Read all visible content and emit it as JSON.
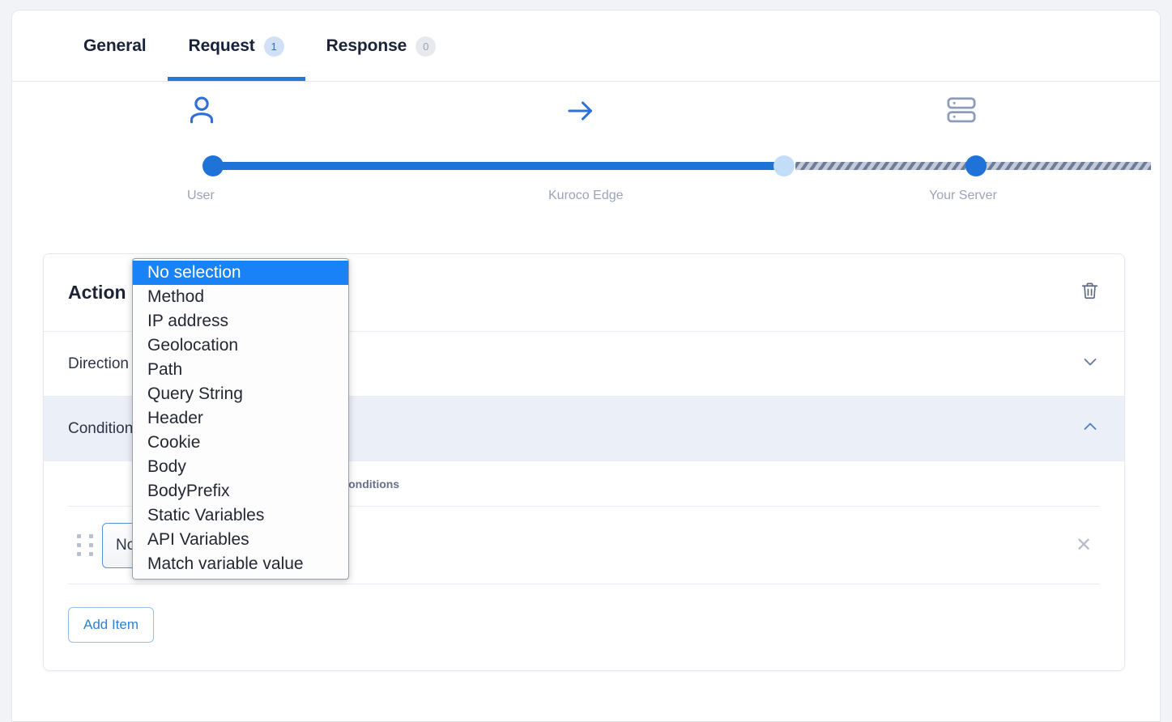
{
  "tabs": [
    {
      "label": "General",
      "badge": null,
      "active": false
    },
    {
      "label": "Request",
      "badge": "1",
      "active": true
    },
    {
      "label": "Response",
      "badge": "0",
      "active": false
    }
  ],
  "flow": {
    "icons": {
      "user": "user-icon",
      "arrow": "arrow-right-icon",
      "server": "server-icon"
    },
    "labels": {
      "start": "User",
      "middle": "Kuroco Edge",
      "end": "Your Server"
    }
  },
  "card": {
    "title": "Action",
    "delete_icon": "trash-icon",
    "rows": [
      {
        "label": "Direction",
        "state": "collapsed",
        "icon": "chevron-down-icon"
      },
      {
        "label": "Conditions",
        "state": "expanded",
        "icon": "chevron-up-icon"
      }
    ],
    "table": {
      "headers": {
        "variable": "",
        "conditions": "Conditions"
      },
      "rows": [
        {
          "drag_handle": "drag-handle-icon",
          "select_value": "No selection",
          "select_chevron": "chevron-down-icon",
          "remove_icon": "close-icon"
        }
      ]
    },
    "add_item_label": "Add Item"
  },
  "dropdown": {
    "open": true,
    "selected": "No selection",
    "options": [
      "No selection",
      "Method",
      "IP address",
      "Geolocation",
      "Path",
      "Query String",
      "Header",
      "Cookie",
      "Body",
      "BodyPrefix",
      "Static Variables",
      "API Variables",
      "Match variable value"
    ]
  },
  "colors": {
    "accent": "#2579d6",
    "highlight": "#1a82f7",
    "selected_row": "#ebeff8",
    "muted": "#9aa4b8"
  }
}
